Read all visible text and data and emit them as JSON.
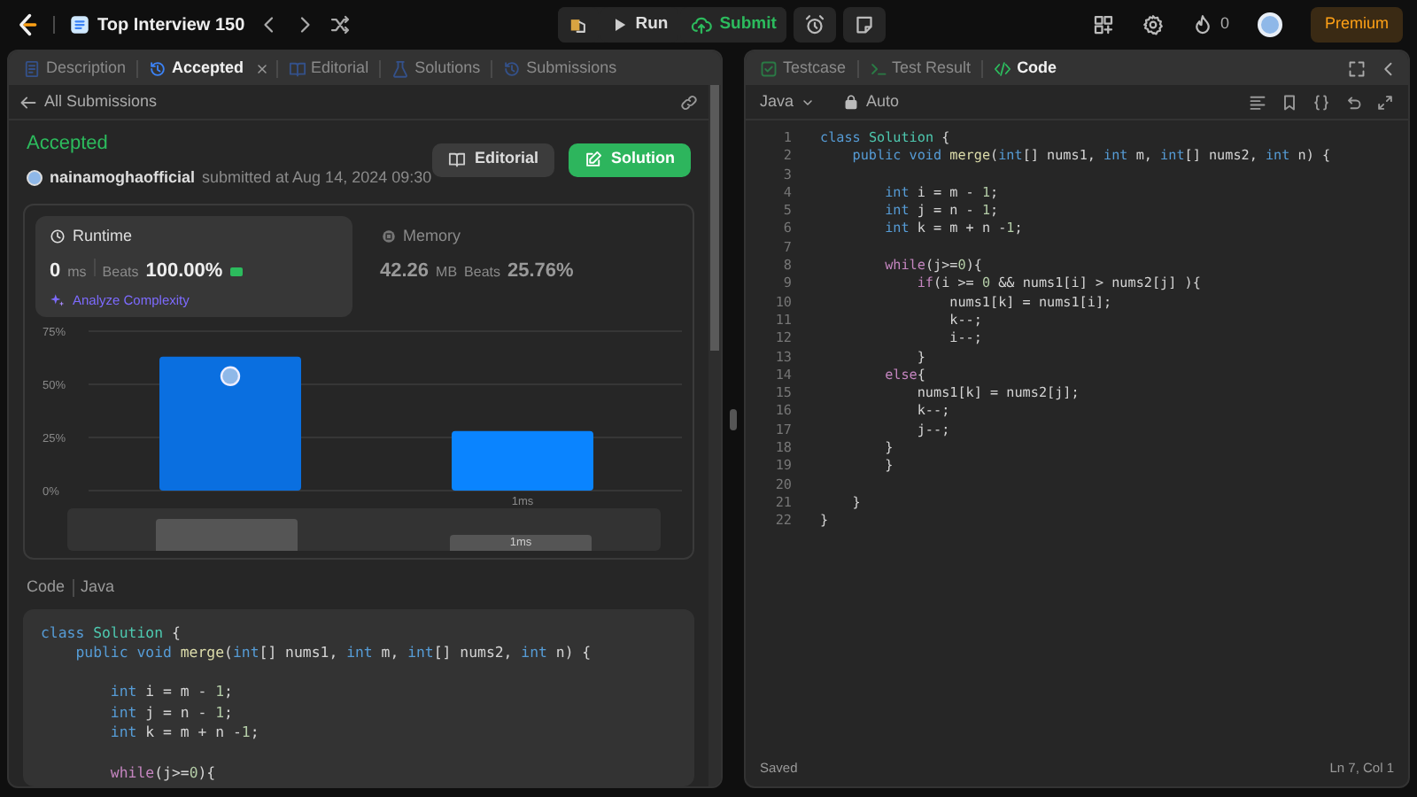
{
  "topbar": {
    "title": "Top Interview 150",
    "actions": [
      {
        "label": "Run",
        "kind": "run"
      },
      {
        "label": "Submit",
        "kind": "submit"
      }
    ],
    "streak": "0",
    "premium": "Premium"
  },
  "left_panel": {
    "tabs": [
      {
        "label": "Description",
        "selected": false,
        "closable": false
      },
      {
        "label": "Accepted",
        "selected": true,
        "closable": true
      },
      {
        "label": "Editorial",
        "selected": false,
        "closable": false
      },
      {
        "label": "Solutions",
        "selected": false,
        "closable": false
      },
      {
        "label": "Submissions",
        "selected": false,
        "closable": false
      }
    ],
    "back_link": "All Submissions",
    "status": "Accepted",
    "author": "nainamoghaofficial",
    "submitted": "submitted at Aug 14, 2024 09:30",
    "buttons": [
      {
        "label": "Editorial",
        "kind": "secondary"
      },
      {
        "label": "Solution",
        "kind": "primary"
      }
    ],
    "metrics": [
      {
        "title": "Runtime",
        "value": "0",
        "unit": "ms",
        "beats_label": "Beats",
        "beats": "100.00%",
        "selected": true,
        "link": "Analyze Complexity"
      },
      {
        "title": "Memory",
        "value": "42.26",
        "unit": "MB",
        "beats_label": "Beats",
        "beats": "25.76%",
        "selected": false
      }
    ],
    "chart_data": {
      "type": "bar",
      "categories": [
        null,
        "1ms"
      ],
      "values": [
        63,
        28
      ],
      "ylim": [
        0,
        75
      ],
      "yticks": [
        {
          "value": 0,
          "label": "0%"
        },
        {
          "value": 25,
          "label": "25%"
        },
        {
          "value": 50,
          "label": "50%"
        },
        {
          "value": 75,
          "label": "75%"
        }
      ]
    },
    "range_label": "1ms",
    "code_label": "Code",
    "code_language": "Java",
    "code_lines": [
      {
        "kind": "code",
        "tokens": [
          {
            "kind": "kw",
            "text": "class "
          },
          {
            "kind": "type",
            "text": "Solution"
          },
          {
            "kind": "p",
            "text": " {"
          }
        ]
      },
      {
        "kind": "code",
        "tokens": [
          {
            "kind": "kw",
            "text": "    public void "
          },
          {
            "kind": "fn",
            "text": "merge"
          },
          {
            "kind": "p",
            "text": "("
          },
          {
            "kind": "kw",
            "text": "int"
          },
          {
            "kind": "p",
            "text": "[] nums1, "
          },
          {
            "kind": "kw",
            "text": "int"
          },
          {
            "kind": "p",
            "text": " m, "
          },
          {
            "kind": "kw",
            "text": "int"
          },
          {
            "kind": "p",
            "text": "[] nums2, "
          },
          {
            "kind": "kw",
            "text": "int"
          },
          {
            "kind": "p",
            "text": " n) {"
          }
        ]
      },
      {
        "kind": "blank"
      },
      {
        "kind": "code",
        "tokens": [
          {
            "kind": "kw",
            "text": "        int"
          },
          {
            "kind": "p",
            "text": " i = m - "
          },
          {
            "kind": "num",
            "text": "1"
          },
          {
            "kind": "p",
            "text": ";"
          }
        ]
      },
      {
        "kind": "code",
        "tokens": [
          {
            "kind": "kw",
            "text": "        int"
          },
          {
            "kind": "p",
            "text": " j = n - "
          },
          {
            "kind": "num",
            "text": "1"
          },
          {
            "kind": "p",
            "text": ";"
          }
        ]
      },
      {
        "kind": "code",
        "tokens": [
          {
            "kind": "kw",
            "text": "        int"
          },
          {
            "kind": "p",
            "text": " k = m + n -"
          },
          {
            "kind": "num",
            "text": "1"
          },
          {
            "kind": "p",
            "text": ";"
          }
        ]
      },
      {
        "kind": "blank"
      },
      {
        "kind": "code",
        "tokens": [
          {
            "kind": "ctl",
            "text": "        while"
          },
          {
            "kind": "p",
            "text": "(j>="
          },
          {
            "kind": "num",
            "text": "0"
          },
          {
            "kind": "p",
            "text": "){"
          }
        ]
      }
    ]
  },
  "right_panel": {
    "tabs": [
      {
        "label": "Testcase",
        "selected": false
      },
      {
        "label": "Test Result",
        "selected": false
      },
      {
        "label": "Code",
        "selected": true
      }
    ],
    "language": "Java",
    "mode": "Auto",
    "lines": [
      {
        "no": "1",
        "kind": "code",
        "tokens": [
          {
            "kind": "kw",
            "text": "class "
          },
          {
            "kind": "type",
            "text": "Solution"
          },
          {
            "kind": "p",
            "text": " {"
          }
        ]
      },
      {
        "no": "2",
        "kind": "code",
        "tokens": [
          {
            "kind": "kw",
            "text": "    public void "
          },
          {
            "kind": "fn",
            "text": "merge"
          },
          {
            "kind": "p",
            "text": "("
          },
          {
            "kind": "kw",
            "text": "int"
          },
          {
            "kind": "p",
            "text": "[] nums1, "
          },
          {
            "kind": "kw",
            "text": "int"
          },
          {
            "kind": "p",
            "text": " m, "
          },
          {
            "kind": "kw",
            "text": "int"
          },
          {
            "kind": "p",
            "text": "[] nums2, "
          },
          {
            "kind": "kw",
            "text": "int"
          },
          {
            "kind": "p",
            "text": " n) {"
          }
        ]
      },
      {
        "no": "3",
        "kind": "blank"
      },
      {
        "no": "4",
        "kind": "code",
        "tokens": [
          {
            "kind": "kw",
            "text": "        int"
          },
          {
            "kind": "p",
            "text": " i = m - "
          },
          {
            "kind": "num",
            "text": "1"
          },
          {
            "kind": "p",
            "text": ";"
          }
        ]
      },
      {
        "no": "5",
        "kind": "code",
        "tokens": [
          {
            "kind": "kw",
            "text": "        int"
          },
          {
            "kind": "p",
            "text": " j = n - "
          },
          {
            "kind": "num",
            "text": "1"
          },
          {
            "kind": "p",
            "text": ";"
          }
        ]
      },
      {
        "no": "6",
        "kind": "code",
        "tokens": [
          {
            "kind": "kw",
            "text": "        int"
          },
          {
            "kind": "p",
            "text": " k = m + n -"
          },
          {
            "kind": "num",
            "text": "1"
          },
          {
            "kind": "p",
            "text": ";"
          }
        ]
      },
      {
        "no": "7",
        "kind": "blank"
      },
      {
        "no": "8",
        "kind": "code",
        "tokens": [
          {
            "kind": "ctl",
            "text": "        while"
          },
          {
            "kind": "p",
            "text": "(j>="
          },
          {
            "kind": "num",
            "text": "0"
          },
          {
            "kind": "p",
            "text": "){"
          }
        ]
      },
      {
        "no": "9",
        "kind": "code",
        "tokens": [
          {
            "kind": "ctl",
            "text": "            if"
          },
          {
            "kind": "p",
            "text": "(i >= "
          },
          {
            "kind": "num",
            "text": "0"
          },
          {
            "kind": "p",
            "text": " && nums1[i] > nums2[j] ){"
          }
        ]
      },
      {
        "no": "10",
        "kind": "code",
        "tokens": [
          {
            "kind": "p",
            "text": "                nums1[k] = nums1[i];"
          }
        ]
      },
      {
        "no": "11",
        "kind": "code",
        "tokens": [
          {
            "kind": "p",
            "text": "                k--;"
          }
        ]
      },
      {
        "no": "12",
        "kind": "code",
        "tokens": [
          {
            "kind": "p",
            "text": "                i--;"
          }
        ]
      },
      {
        "no": "13",
        "kind": "code",
        "tokens": [
          {
            "kind": "p",
            "text": "            }"
          }
        ]
      },
      {
        "no": "14",
        "kind": "code",
        "tokens": [
          {
            "kind": "ctl",
            "text": "        else"
          },
          {
            "kind": "p",
            "text": "{"
          }
        ]
      },
      {
        "no": "15",
        "kind": "code",
        "tokens": [
          {
            "kind": "p",
            "text": "            nums1[k] = nums2[j];"
          }
        ]
      },
      {
        "no": "16",
        "kind": "code",
        "tokens": [
          {
            "kind": "p",
            "text": "            k--;"
          }
        ]
      },
      {
        "no": "17",
        "kind": "code",
        "tokens": [
          {
            "kind": "p",
            "text": "            j--;"
          }
        ]
      },
      {
        "no": "18",
        "kind": "code",
        "tokens": [
          {
            "kind": "p",
            "text": "        }"
          }
        ]
      },
      {
        "no": "19",
        "kind": "code",
        "tokens": [
          {
            "kind": "p",
            "text": "        }"
          }
        ]
      },
      {
        "no": "20",
        "kind": "blank"
      },
      {
        "no": "21",
        "kind": "code",
        "tokens": [
          {
            "kind": "p",
            "text": "    }"
          }
        ]
      },
      {
        "no": "22",
        "kind": "code",
        "tokens": [
          {
            "kind": "p",
            "text": "}"
          }
        ]
      }
    ],
    "status_left": "Saved",
    "status_right": "Ln 7, Col 1"
  }
}
